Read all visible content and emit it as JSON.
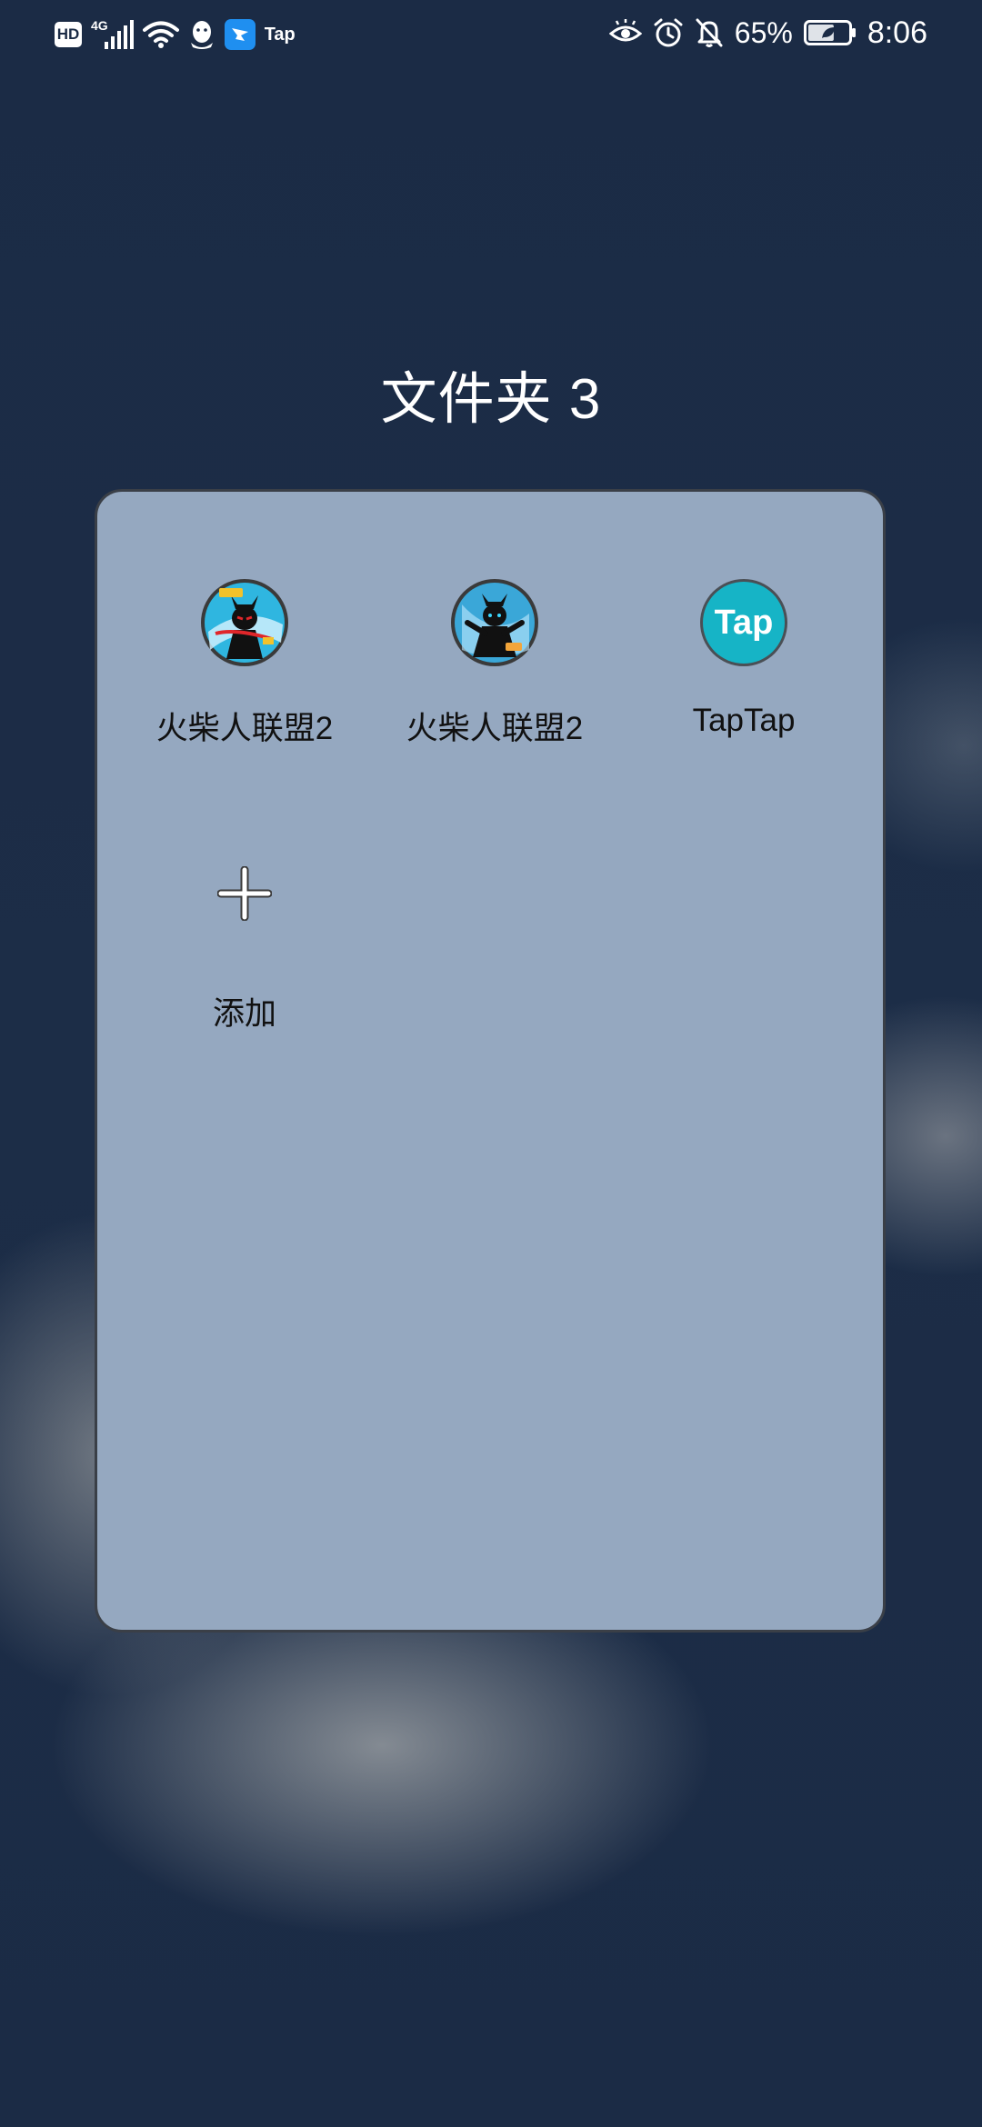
{
  "status_bar": {
    "hd": "HD",
    "network": "4G",
    "tap_label": "Tap",
    "battery_percent": "65%",
    "battery_level": 0.65,
    "time": "8:06"
  },
  "folder": {
    "title": "文件夹 3",
    "apps": [
      {
        "label": "火柴人联盟2",
        "icon": "stickman-league-2-icon"
      },
      {
        "label": "火柴人联盟2",
        "icon": "stickman-league-2-alt-icon"
      },
      {
        "label": "TapTap",
        "icon": "taptap-icon",
        "icon_text": "Tap"
      }
    ],
    "add": {
      "label": "添加",
      "icon": "plus-icon"
    }
  },
  "colors": {
    "background": "#1b2b45",
    "panel": "#95a8c0",
    "taptap": "#16b4c6"
  }
}
